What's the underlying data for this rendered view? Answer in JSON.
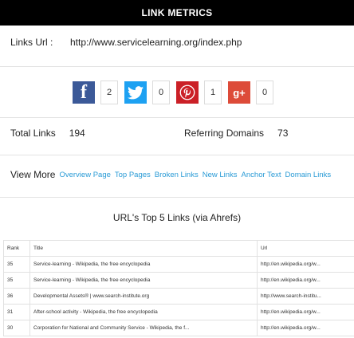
{
  "header": {
    "title": "LINK METRICS"
  },
  "links_url": {
    "label": "Links Url :",
    "value": "http://www.servicelearning.org/index.php"
  },
  "social": [
    {
      "network": "facebook",
      "icon": "facebook-icon",
      "glyph": "f",
      "count": "2",
      "color": "#3b5998"
    },
    {
      "network": "twitter",
      "icon": "twitter-icon",
      "glyph": "",
      "count": "0",
      "color": "#1da1f2"
    },
    {
      "network": "pinterest",
      "icon": "pinterest-icon",
      "glyph": "",
      "count": "1",
      "color": "#cb2027"
    },
    {
      "network": "google-plus",
      "icon": "google-plus-icon",
      "glyph": "g+",
      "count": "0",
      "color": "#dd4b39"
    }
  ],
  "totals": {
    "total_links_label": "Total Links",
    "total_links_value": "194",
    "referring_domains_label": "Referring Domains",
    "referring_domains_value": "73"
  },
  "view_more": {
    "label": "View More",
    "links": [
      "Overview Page",
      "Top Pages",
      "Broken Links",
      "New Links",
      "Anchor Text",
      "Domain Links"
    ]
  },
  "top_links": {
    "title": "URL's Top 5 Links (via Ahrefs)",
    "columns": [
      "Rank",
      "Title",
      "Url"
    ],
    "rows": [
      {
        "rank": "35",
        "title": "Service-learning - Wikipedia, the free encyclopedia",
        "url": "http://en.wikipedia.org/w..."
      },
      {
        "rank": "35",
        "title": "Service-learning - Wikipedia, the free encyclopedia",
        "url": "http://en.wikipedia.org/w..."
      },
      {
        "rank": "36",
        "title": "Developmental Assets® | www.search-institute.org",
        "url": "http://www.search-institu..."
      },
      {
        "rank": "31",
        "title": "After-school activity - Wikipedia, the free encyclopedia",
        "url": "http://en.wikipedia.org/w..."
      },
      {
        "rank": "30",
        "title": "Corporation for National and Community Service - Wikipedia, the f...",
        "url": "http://en.wikipedia.org/w..."
      }
    ]
  }
}
